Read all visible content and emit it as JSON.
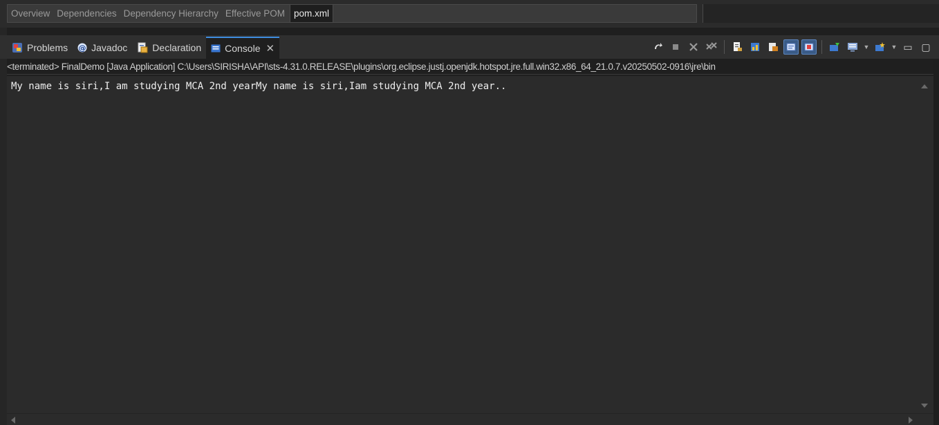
{
  "editor_tabs": [
    {
      "label": "Overview",
      "active": false
    },
    {
      "label": "Dependencies",
      "active": false
    },
    {
      "label": "Dependency Hierarchy",
      "active": false
    },
    {
      "label": "Effective POM",
      "active": false
    },
    {
      "label": "pom.xml",
      "active": true
    }
  ],
  "view_tabs": {
    "problems": {
      "label": "Problems",
      "icon": "problems-icon"
    },
    "javadoc": {
      "label": "Javadoc",
      "icon": "javadoc-at-icon"
    },
    "declaration": {
      "label": "Declaration",
      "icon": "declaration-icon"
    },
    "console": {
      "label": "Console",
      "icon": "console-icon",
      "active": true,
      "close": "✕"
    }
  },
  "toolbar": {
    "icons": [
      "rerun-icon",
      "terminate-icon",
      "remove-launch-icon",
      "remove-all-terminated-icon",
      "clear-console-icon",
      "scroll-lock-icon",
      "word-wrap-icon",
      "show-stdout-icon",
      "show-stderr-icon",
      "pin-console-icon",
      "display-console-icon",
      "open-console-icon",
      "minimize-icon",
      "maximize-icon"
    ],
    "minimize": "▭",
    "maximize": "▢"
  },
  "console": {
    "info_line": "<terminated> FinalDemo [Java Application] C:\\Users\\SIRISHA\\API\\sts-4.31.0.RELEASE\\plugins\\org.eclipse.justj.openjdk.hotspot.jre.full.win32.x86_64_21.0.7.v20250502-0916\\jre\\bin",
    "output": "My name is siri,I am studying MCA 2nd yearMy name is siri,Iam studying MCA 2nd year.."
  },
  "colors": {
    "accent": "#3e8de0",
    "background": "#2b2b2b",
    "text": "#eeeeee"
  }
}
